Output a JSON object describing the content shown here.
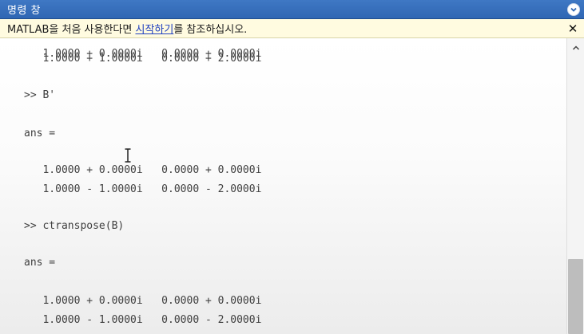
{
  "window": {
    "title": "명령 창",
    "menu_icon": "chevron-down-circle-icon"
  },
  "infobar": {
    "text_before": "MATLAB을 처음 사용한다면 ",
    "link": "시작하기",
    "text_after": "를 참조하십시오.",
    "close_glyph": "✕"
  },
  "console": {
    "lines": [
      "   1.0000 + 0.0000i   0.0000 + 0.0000i",
      "   1.0000 + 1.0000i   0.0000 + 2.0000i",
      ">> B'",
      "ans =",
      "   1.0000 + 0.0000i   0.0000 + 0.0000i",
      "   1.0000 - 1.0000i   0.0000 - 2.0000i",
      ">> ctranspose(B)",
      "ans =",
      "   1.0000 + 0.0000i   0.0000 + 0.0000i",
      "   1.0000 - 1.0000i   0.0000 - 2.0000i"
    ]
  },
  "scrollbar": {
    "up_icon": "chevron-up-icon"
  },
  "colors": {
    "titlebar": "#2f66b3",
    "infobar_bg": "#fffbe0",
    "link": "#1f3fbf",
    "console_text": "#404040"
  }
}
